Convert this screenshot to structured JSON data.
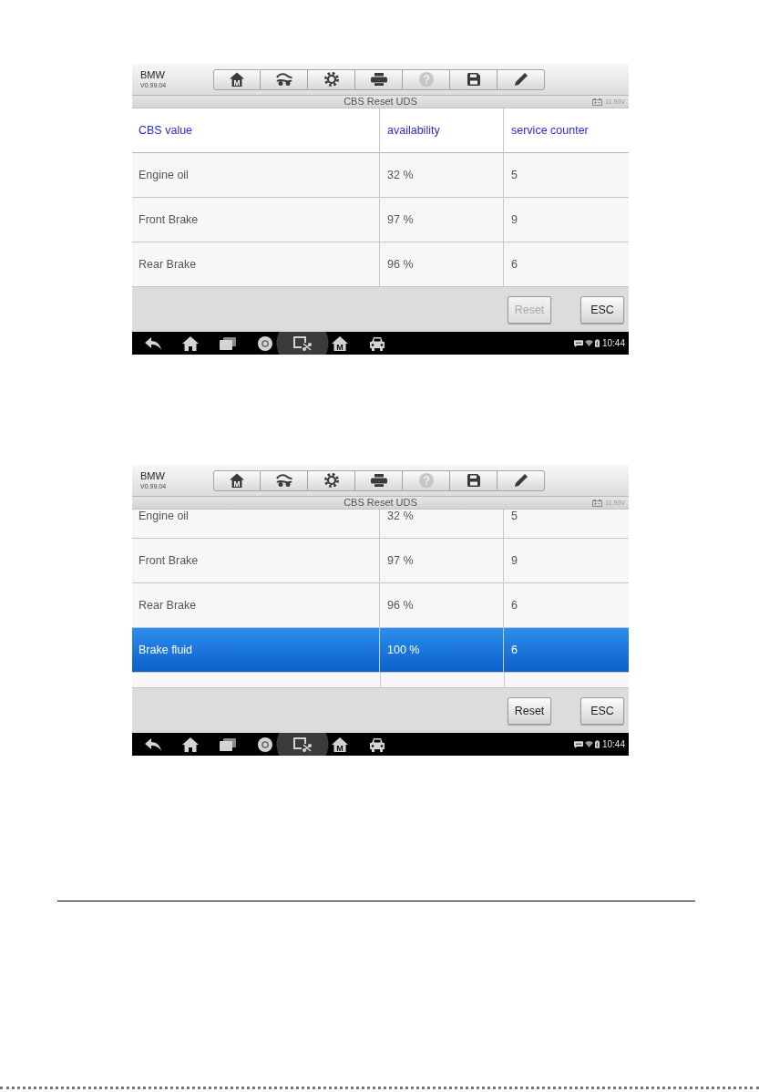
{
  "screens": [
    {
      "app": {
        "name": "BMW",
        "version": "V0.99.04"
      },
      "toolbar": [
        {
          "kind": "home",
          "glyph": "M",
          "disabled": false
        },
        {
          "kind": "vehicle",
          "disabled": false
        },
        {
          "kind": "settings",
          "disabled": false
        },
        {
          "kind": "print",
          "disabled": false
        },
        {
          "kind": "help",
          "disabled": true
        },
        {
          "kind": "save",
          "disabled": false
        },
        {
          "kind": "edit",
          "disabled": false
        }
      ],
      "title": "CBS Reset UDS",
      "voltage": "11.90V",
      "table": {
        "columns": [
          "CBS value",
          "availability",
          "service counter"
        ],
        "scrolled": false,
        "rows": [
          {
            "cells": [
              "Engine oil",
              "32 %",
              "5"
            ],
            "selected": false
          },
          {
            "cells": [
              "Front Brake",
              "97 %",
              "9"
            ],
            "selected": false
          },
          {
            "cells": [
              "Rear Brake",
              "96 %",
              "6"
            ],
            "selected": false
          }
        ]
      },
      "buttons": [
        {
          "label": "Reset",
          "disabled": true
        },
        {
          "label": "ESC",
          "disabled": false
        }
      ],
      "nav_bar": {
        "items": [
          {
            "kind": "back",
            "pressed": false
          },
          {
            "kind": "home",
            "pressed": false
          },
          {
            "kind": "recent",
            "pressed": false
          },
          {
            "kind": "browser",
            "pressed": false
          },
          {
            "kind": "screenshot",
            "pressed": true
          },
          {
            "kind": "home-m",
            "glyph": "M",
            "pressed": false
          },
          {
            "kind": "car",
            "pressed": false
          }
        ],
        "time": "10:44"
      }
    },
    {
      "app": {
        "name": "BMW",
        "version": "V0.99.04"
      },
      "toolbar": [
        {
          "kind": "home",
          "glyph": "M",
          "disabled": false
        },
        {
          "kind": "vehicle",
          "disabled": false
        },
        {
          "kind": "settings",
          "disabled": false
        },
        {
          "kind": "print",
          "disabled": false
        },
        {
          "kind": "help",
          "disabled": true
        },
        {
          "kind": "save",
          "disabled": false
        },
        {
          "kind": "edit",
          "disabled": false
        }
      ],
      "title": "CBS Reset UDS",
      "voltage": "11.90V",
      "table": {
        "scrolled": true,
        "rows": [
          {
            "cells": [
              "Engine oil",
              "32 %",
              "5"
            ],
            "selected": false
          },
          {
            "cells": [
              "Front Brake",
              "97 %",
              "9"
            ],
            "selected": false
          },
          {
            "cells": [
              "Rear Brake",
              "96 %",
              "6"
            ],
            "selected": false
          },
          {
            "cells": [
              "Brake fluid",
              "100 %",
              "6"
            ],
            "selected": true
          }
        ]
      },
      "buttons": [
        {
          "label": "Reset",
          "disabled": false
        },
        {
          "label": "ESC",
          "disabled": false
        }
      ],
      "nav_bar": {
        "items": [
          {
            "kind": "back",
            "pressed": false
          },
          {
            "kind": "home",
            "pressed": false
          },
          {
            "kind": "recent",
            "pressed": false
          },
          {
            "kind": "browser",
            "pressed": false
          },
          {
            "kind": "screenshot",
            "pressed": true
          },
          {
            "kind": "home-m",
            "glyph": "M",
            "pressed": false
          },
          {
            "kind": "car",
            "pressed": false
          }
        ],
        "time": "10:44"
      }
    }
  ]
}
